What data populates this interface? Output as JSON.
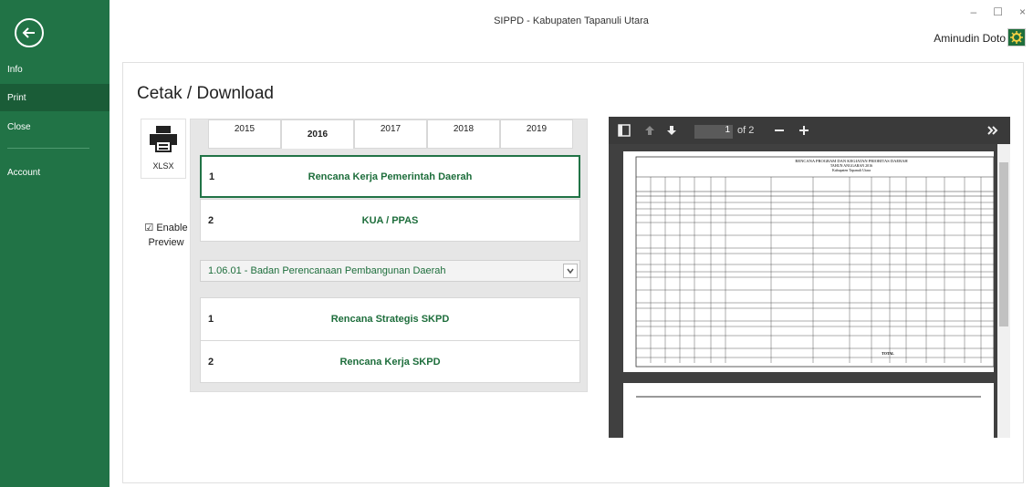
{
  "window": {
    "title": "SIPPD - Kabupaten Tapanuli Utara",
    "controls": [
      "–",
      "☐",
      "×"
    ]
  },
  "user": {
    "name": "Aminudin Doto"
  },
  "sidebar": {
    "back_icon": "back-arrow-icon",
    "items": [
      {
        "label": "Info"
      },
      {
        "label": "Print"
      },
      {
        "label": "Close"
      },
      {
        "label": "Account"
      }
    ]
  },
  "main": {
    "title": "Cetak / Download",
    "xlsx_label": "XLSX",
    "enable_preview": "Enable Preview",
    "years": [
      "2015",
      "2016",
      "2017",
      "2018",
      "2019"
    ],
    "active_year": "2016",
    "reports_top": [
      {
        "num": "1",
        "label": "Rencana Kerja Pemerintah Daerah"
      },
      {
        "num": "2",
        "label": "KUA / PPAS"
      }
    ],
    "skpd_select": "1.06.01 - Badan Perencanaan Pembangunan Daerah",
    "reports_skpd": [
      {
        "num": "1",
        "label": "Rencana Strategis SKPD"
      },
      {
        "num": "2",
        "label": "Rencana Kerja SKPD"
      }
    ]
  },
  "preview": {
    "page_current": "1",
    "page_total": "of 2",
    "doc_title": "RENCANA PROGRAM DAN KEGIATAN PRIORITAS DAERAH",
    "doc_subtitle": "TAHUN ANGGARAN 2016",
    "doc_region": "Kabupaten Tapanuli Utara",
    "footer_label": "TOTAL"
  },
  "colors": {
    "accent": "#217346",
    "label_green": "#1e6e3c"
  }
}
